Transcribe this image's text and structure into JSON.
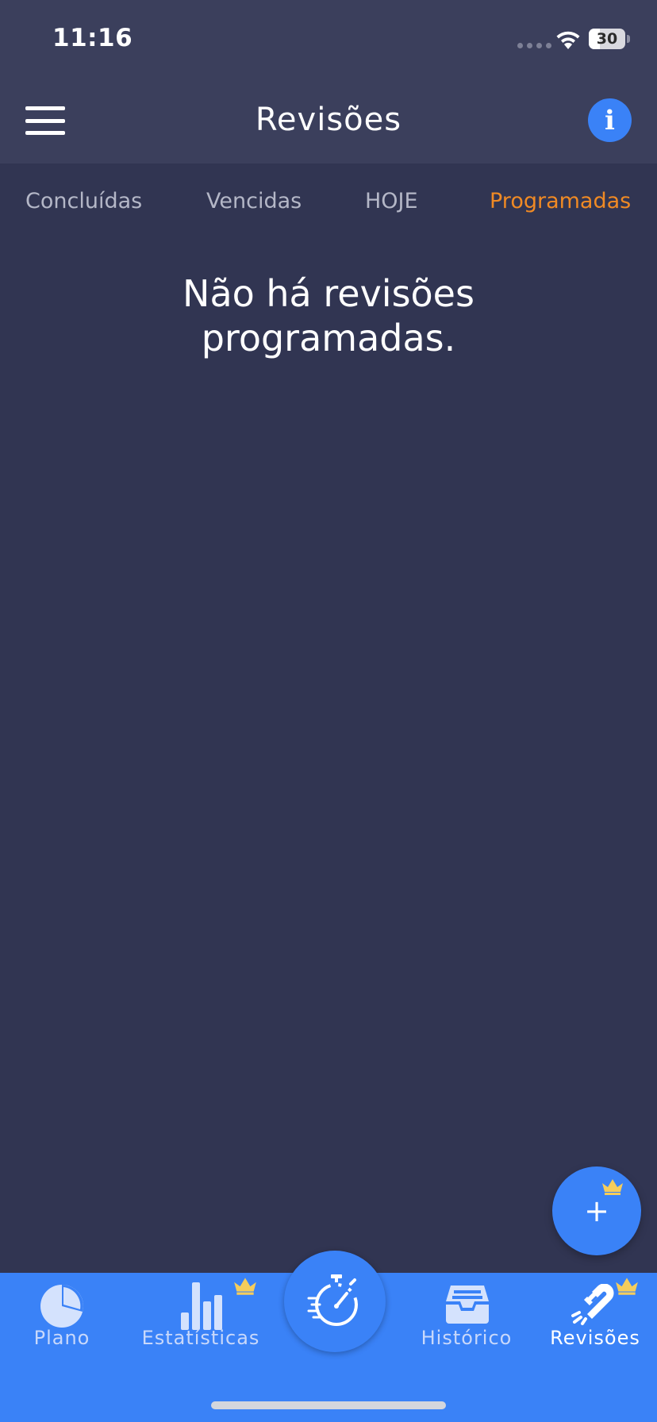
{
  "status_bar": {
    "time": "11:16",
    "battery_level": "30",
    "battery_fraction": 0.3
  },
  "header": {
    "title": "Revisões",
    "info_label": "i"
  },
  "tabs": [
    {
      "label": "Concluídas",
      "active": false
    },
    {
      "label": "Vencidas",
      "active": false
    },
    {
      "label": "HOJE",
      "active": false
    },
    {
      "label": "Programadas",
      "active": true
    }
  ],
  "empty_state": {
    "line1": "Não há revisões",
    "line2": "programadas."
  },
  "fab": {
    "label": "+"
  },
  "bottom_nav": {
    "items": [
      {
        "label": "Plano",
        "icon": "pie-chart-icon",
        "premium": false
      },
      {
        "label": "Estatísticas",
        "icon": "bar-chart-icon",
        "premium": true
      },
      {
        "label": "Histórico",
        "icon": "archive-icon",
        "premium": false
      },
      {
        "label": "Revisões",
        "icon": "magnet-icon",
        "premium": true,
        "active": true
      }
    ],
    "center_icon": "stopwatch-icon"
  },
  "colors": {
    "background": "#313552",
    "header": "#3b3f5c",
    "accent": "#3a82f7",
    "active_tab": "#f08a24",
    "crown": "#f5cd5c"
  }
}
